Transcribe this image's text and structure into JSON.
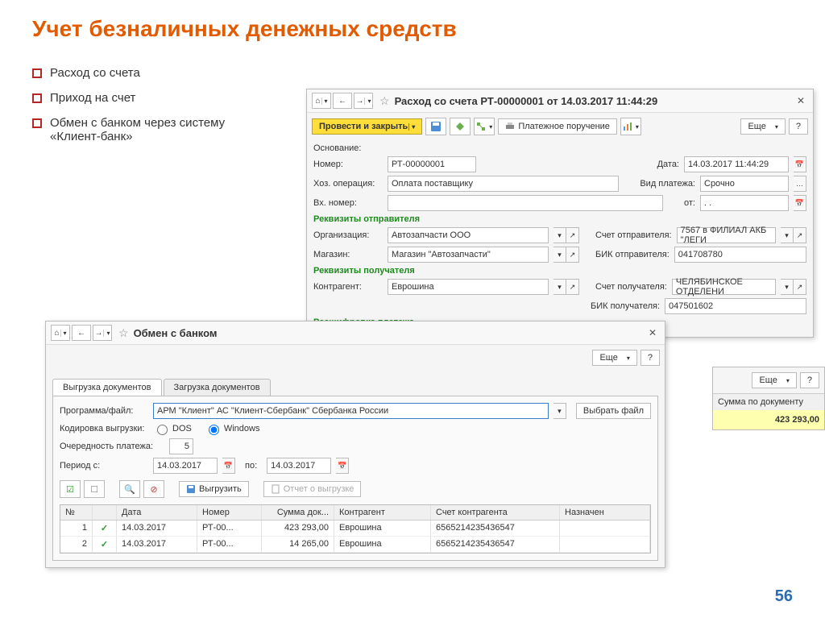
{
  "slide": {
    "title": "Учет безналичных денежных средств",
    "bullets": [
      "Расход со счета",
      "Приход на счет",
      "Обмен с банком через систему «Клиент-банк»"
    ],
    "page_number": "56"
  },
  "win_expense": {
    "title": "Расход со счета РТ-00000001 от 14.03.2017 11:44:29",
    "buttons": {
      "post_close": "Провести и закрыть",
      "payment_order": "Платежное поручение",
      "more": "Еще",
      "help": "?"
    },
    "labels": {
      "basis": "Основание:",
      "number": "Номер:",
      "date": "Дата:",
      "operation": "Хоз. операция:",
      "payment_type": "Вид платежа:",
      "ext_number": "Вх. номер:",
      "from": "от:",
      "sender_req": "Реквизиты отправителя",
      "organization": "Организация:",
      "sender_account": "Счет отправителя:",
      "store": "Магазин:",
      "sender_bic": "БИК отправителя:",
      "receiver_req": "Реквизиты получателя",
      "contractor": "Контрагент:",
      "receiver_account": "Счет получателя:",
      "receiver_bic": "БИК получателя:",
      "details": "Расшифровка платежа"
    },
    "values": {
      "number": "РТ-00000001",
      "date": "14.03.2017 11:44:29",
      "operation": "Оплата поставщику",
      "payment_type": "Срочно",
      "ext_from": ". .",
      "organization": "Автозапчасти ООО",
      "sender_account": "7567 в ФИЛИАЛ АКБ \"ЛЕГИ",
      "store": "Магазин \"Автозапчасти\"",
      "sender_bic": "041708780",
      "contractor": "Еврошина",
      "receiver_account": "ЧЕЛЯБИНСКОЕ ОТДЕЛЕНИ",
      "receiver_bic": "047501602"
    }
  },
  "win_exchange": {
    "title": "Обмен с банком",
    "buttons": {
      "more": "Еще",
      "help": "?",
      "choose_file": "Выбрать файл",
      "export": "Выгрузить",
      "report": "Отчет о выгрузке"
    },
    "tabs": {
      "export": "Выгрузка документов",
      "import": "Загрузка документов"
    },
    "labels": {
      "program": "Программа/файл:",
      "encoding": "Кодировка выгрузки:",
      "enc_dos": "DOS",
      "enc_win": "Windows",
      "priority": "Очередность платежа:",
      "period_from": "Период с:",
      "period_to": "по:"
    },
    "values": {
      "program": "АРМ \"Клиент\" АС \"Клиент-Сбербанк\" Сбербанка России",
      "priority": "5",
      "period_from": "14.03.2017",
      "period_to": "14.03.2017"
    },
    "grid": {
      "headers": {
        "num": "№",
        "check": "",
        "date": "Дата",
        "number": "Номер",
        "sum": "Сумма док...",
        "contractor": "Контрагент",
        "account": "Счет контрагента",
        "purpose": "Назначен"
      },
      "rows": [
        {
          "num": "1",
          "date": "14.03.2017",
          "number": "РТ-00...",
          "sum": "423 293,00",
          "contractor": "Еврошина",
          "account": "6565214235436547"
        },
        {
          "num": "2",
          "date": "14.03.2017",
          "number": "РТ-00...",
          "sum": "14 265,00",
          "contractor": "Еврошина",
          "account": "6565214235436547"
        }
      ]
    }
  },
  "side": {
    "buttons": {
      "more": "Еще",
      "help": "?"
    },
    "header": "Сумма по документу",
    "value": "423 293,00"
  }
}
